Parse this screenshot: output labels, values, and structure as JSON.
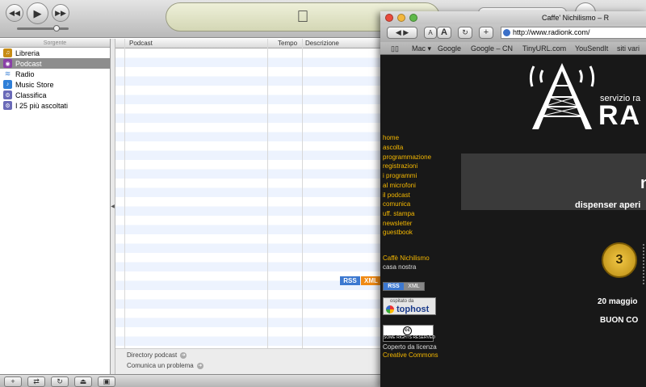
{
  "itunes": {
    "lcd_icon": "apple-logo",
    "sidebar": {
      "header": "Sorgente",
      "items": [
        {
          "label": "Libreria",
          "icon": "library-icon",
          "color": "#c78c14"
        },
        {
          "label": "Podcast",
          "icon": "podcast-icon",
          "color": "#8a3fa8"
        },
        {
          "label": "Radio",
          "icon": "radio-icon",
          "color": "#4a8ad8"
        },
        {
          "label": "Music Store",
          "icon": "music-store-icon",
          "color": "#2f7fd8"
        },
        {
          "label": "Classifica",
          "icon": "playlist-icon",
          "color": "#6a6ab8"
        },
        {
          "label": "I 25 più ascoltati",
          "icon": "playlist-icon",
          "color": "#6a6ab8"
        }
      ]
    },
    "list": {
      "columns": [
        "Podcast",
        "Tempo",
        "Descrizione"
      ],
      "footer_links": [
        "Directory podcast",
        "Comunica un problema"
      ],
      "feed_badges": [
        "RSS",
        "XML"
      ]
    },
    "bottom_buttons": [
      "+",
      "shuffle",
      "repeat",
      "eject",
      "visualizer"
    ]
  },
  "safari": {
    "title": "Caffe' Nichilismo – R",
    "url": "http://www.radionk.com/",
    "text_buttons": [
      "A",
      "A",
      "+"
    ],
    "bookmarks": [
      "Mac",
      "Google",
      "Google – CN",
      "TinyURL.com",
      "YouSendIt",
      "siti vari"
    ],
    "site": {
      "logo_caption": "servizio ra",
      "logo_big": "RA",
      "nav": [
        "home",
        "ascolta",
        "programmazione",
        "registrazioni",
        "i programmi",
        "al microfoni",
        "il podcast",
        "comunica",
        "uff. stampa",
        "newsletter",
        "guestbook"
      ],
      "caffe_link": "Caffè Nichilismo",
      "caffe_sub": "casa nostra",
      "rss_badges": [
        "RSS",
        "XML"
      ],
      "tophost_top": "ospitato da",
      "tophost_brand": "tophost",
      "cc_text": "SOME RIGHTS RESERVED",
      "cc_caption": "Coperto da licenza",
      "cc_link": "Creative Commons",
      "banner_letter": "n",
      "tagline": "dispenser aperi",
      "medal_number": "3",
      "date_text": "20 maggio",
      "greeting": "BUON CO"
    }
  }
}
